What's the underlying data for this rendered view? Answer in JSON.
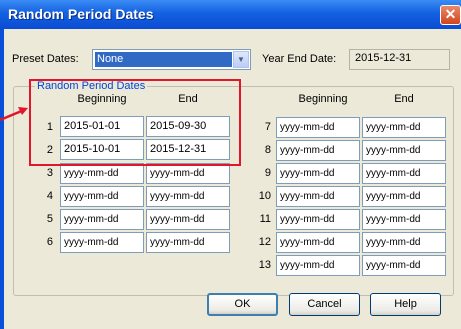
{
  "window": {
    "title": "Random Period Dates",
    "close_glyph": "✕"
  },
  "preset": {
    "label": "Preset Dates:",
    "value": "None"
  },
  "year_end": {
    "label": "Year End Date:",
    "value": "2015-12-31"
  },
  "group": {
    "title": "Random Period Dates"
  },
  "headers": {
    "beginning": "Beginning",
    "end": "End"
  },
  "left_rows": [
    {
      "num": "1",
      "beginning": "2015-01-01",
      "end": "2015-09-30"
    },
    {
      "num": "2",
      "beginning": "2015-10-01",
      "end": "2015-12-31"
    },
    {
      "num": "3",
      "beginning": "yyyy-mm-dd",
      "end": "yyyy-mm-dd"
    },
    {
      "num": "4",
      "beginning": "yyyy-mm-dd",
      "end": "yyyy-mm-dd"
    },
    {
      "num": "5",
      "beginning": "yyyy-mm-dd",
      "end": "yyyy-mm-dd"
    },
    {
      "num": "6",
      "beginning": "yyyy-mm-dd",
      "end": "yyyy-mm-dd"
    }
  ],
  "right_rows": [
    {
      "num": "7",
      "beginning": "yyyy-mm-dd",
      "end": "yyyy-mm-dd"
    },
    {
      "num": "8",
      "beginning": "yyyy-mm-dd",
      "end": "yyyy-mm-dd"
    },
    {
      "num": "9",
      "beginning": "yyyy-mm-dd",
      "end": "yyyy-mm-dd"
    },
    {
      "num": "10",
      "beginning": "yyyy-mm-dd",
      "end": "yyyy-mm-dd"
    },
    {
      "num": "11",
      "beginning": "yyyy-mm-dd",
      "end": "yyyy-mm-dd"
    },
    {
      "num": "12",
      "beginning": "yyyy-mm-dd",
      "end": "yyyy-mm-dd"
    },
    {
      "num": "13",
      "beginning": "yyyy-mm-dd",
      "end": "yyyy-mm-dd"
    }
  ],
  "buttons": {
    "ok": "OK",
    "cancel": "Cancel",
    "help": "Help"
  },
  "colors": {
    "titlebar": "#0a4cd4",
    "dialog": "#ece9d8",
    "annotation": "#e2162a",
    "group_title": "#0046d5"
  }
}
